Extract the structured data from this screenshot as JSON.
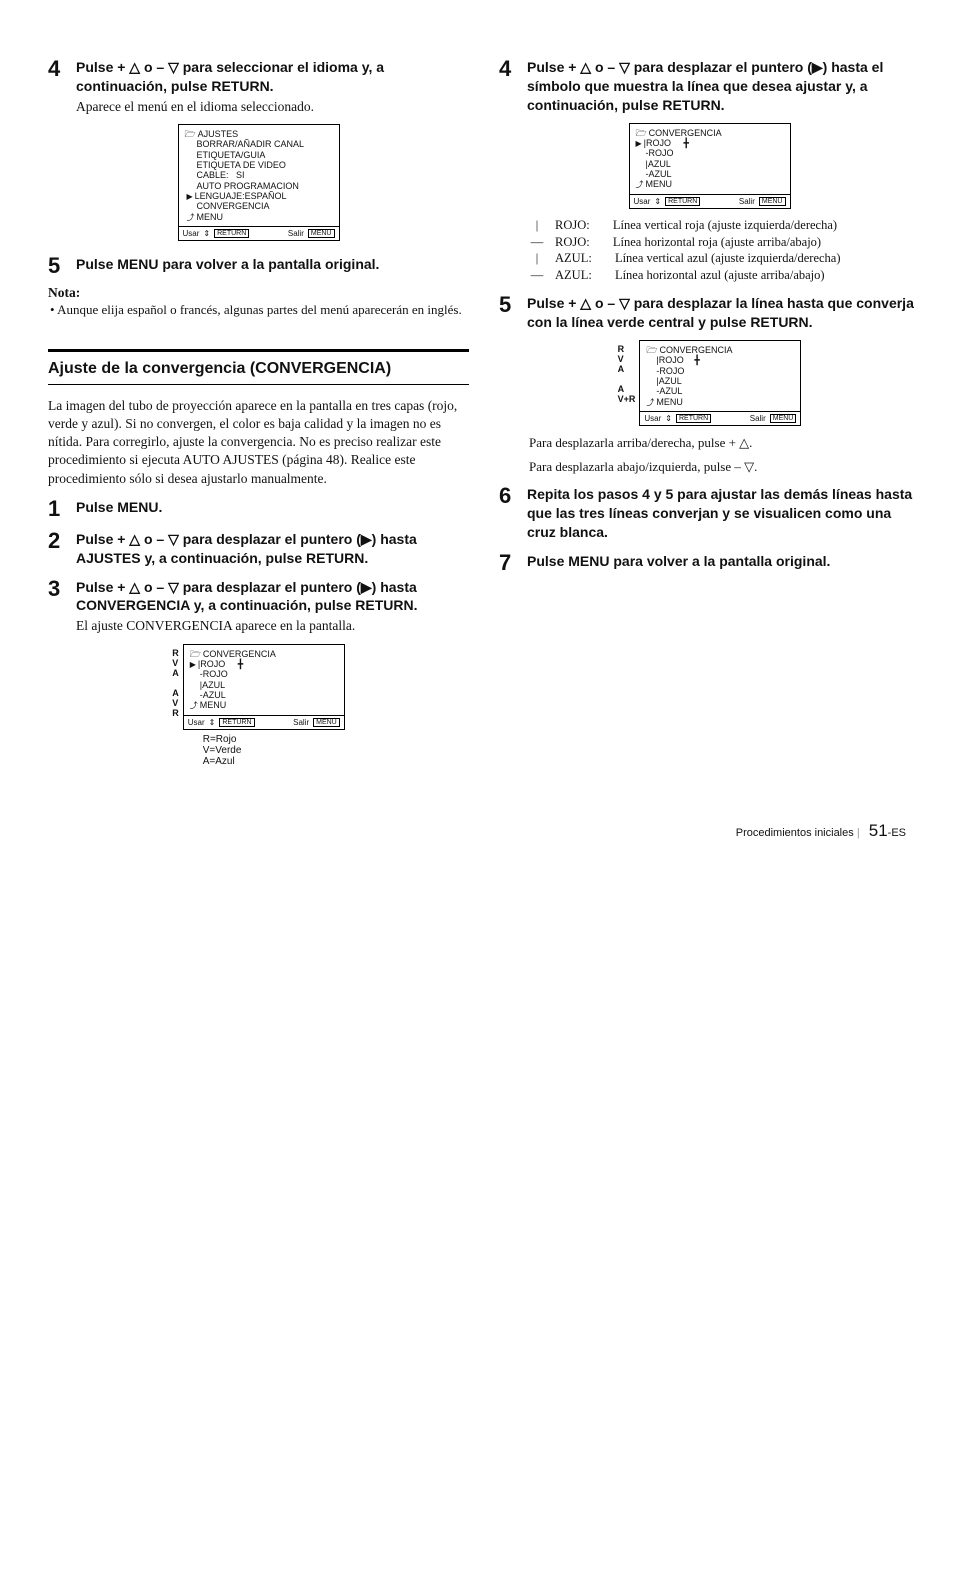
{
  "left": {
    "step4": {
      "num": "4",
      "title": "Pulse + △ o – ▽ para seleccionar el idioma y, a continuación, pulse RETURN.",
      "sub": "Aparece el menú en el idioma seleccionado."
    },
    "osd1": {
      "title": "AJUSTES",
      "l1": "BORRAR/AÑADIR CANAL",
      "l2": "ETIQUETA/GUIA",
      "l3": "ETIQUETA DE VIDEO",
      "l4": "CABLE:   SI",
      "l5": "AUTO PROGRAMACION",
      "l6": "LENGUAJE:ESPAÑOL",
      "l7": "CONVERGENCIA",
      "l8": "MENU",
      "usar": "Usar",
      "retrn": "RETURN",
      "salir": "Salir",
      "menu": "MENU"
    },
    "step5": {
      "num": "5",
      "title": "Pulse MENU para volver a la pantalla original."
    },
    "nota_head": "Nota:",
    "nota_body": "• Aunque elija español o francés, algunas partes del menú aparecerán en inglés.",
    "section_title": "Ajuste de la convergencia (CONVERGENCIA)",
    "section_para": "La imagen del tubo de proyección aparece en la pantalla en tres capas (rojo, verde y azul). Si no convergen, el color es baja calidad y la imagen no es nítida. Para corregirlo, ajuste la convergencia. No es preciso realizar este procedimiento si ejecuta AUTO AJUSTES (página 48). Realice este procedimiento sólo si desea ajustarlo manualmente.",
    "step1": {
      "num": "1",
      "title": "Pulse MENU."
    },
    "step2": {
      "num": "2",
      "title": "Pulse + △ o – ▽ para desplazar el puntero (▶) hasta AJUSTES y, a continuación, pulse RETURN."
    },
    "step3": {
      "num": "3",
      "title": "Pulse + △ o – ▽ para desplazar el puntero (▶) hasta CONVERGENCIA y, a continuación, pulse RETURN.",
      "sub": "El ajuste CONVERGENCIA aparece en la pantalla."
    },
    "convg1": {
      "labL": "R\nV\nA\n\nA\nV\nR",
      "title": "CONVERGENCIA",
      "l1": "|ROJO",
      "l2": "-ROJO",
      "l3": "|AZUL",
      "l4": "-AZUL",
      "l5": "MENU",
      "legend": "R=Rojo\nV=Verde\nA=Azul",
      "usar": "Usar",
      "retrn": "RETURN",
      "salir": "Salir",
      "menu": "MENU"
    }
  },
  "right": {
    "step4": {
      "num": "4",
      "title": "Pulse  + △ o – ▽ para desplazar el puntero (▶) hasta el símbolo que muestra la línea que desea ajustar y, a continuación, pulse RETURN."
    },
    "convg2": {
      "title": "CONVERGENCIA",
      "l1": "|ROJO",
      "l2": "-ROJO",
      "l3": "|AZUL",
      "l4": "-AZUL",
      "l5": "MENU",
      "usar": "Usar",
      "retrn": "RETURN",
      "salir": "Salir",
      "menu": "MENU"
    },
    "legend": {
      "r1s": "|",
      "r1l": "ROJO:",
      "r1t": "Línea vertical roja (ajuste izquierda/derecha)",
      "r2s": "—",
      "r2l": "ROJO:",
      "r2t": "Línea horizontal roja (ajuste arriba/abajo)",
      "r3s": "|",
      "r3l": "AZUL:",
      "r3t": "Línea vertical azul (ajuste izquierda/derecha)",
      "r4s": "—",
      "r4l": "AZUL:",
      "r4t": "Línea horizontal azul (ajuste arriba/abajo)"
    },
    "step5": {
      "num": "5",
      "title": "Pulse + △ o – ▽ para desplazar la línea hasta que converja con la línea verde central y pulse RETURN."
    },
    "convg3": {
      "labL": "R\nV\nA\n\nA\nV+R",
      "title": "CONVERGENCIA",
      "l1": "|ROJO",
      "l2": "-ROJO",
      "l3": "|AZUL",
      "l4": "-AZUL",
      "l5": "MENU",
      "usar": "Usar",
      "retrn": "RETURN",
      "salir": "Salir",
      "menu": "MENU"
    },
    "help1": "Para desplazarla arriba/derecha, pulse + △.",
    "help2": "Para desplazarla abajo/izquierda, pulse – ▽.",
    "step6": {
      "num": "6",
      "title": "Repita los pasos 4 y 5 para ajustar las demás líneas hasta que las tres líneas converjan y se visualicen como una cruz blanca."
    },
    "step7": {
      "num": "7",
      "title": "Pulse MENU para volver a la pantalla original."
    }
  },
  "footer": {
    "section": "Procedimientos iniciales",
    "pg": "51",
    "suf": "-ES"
  }
}
